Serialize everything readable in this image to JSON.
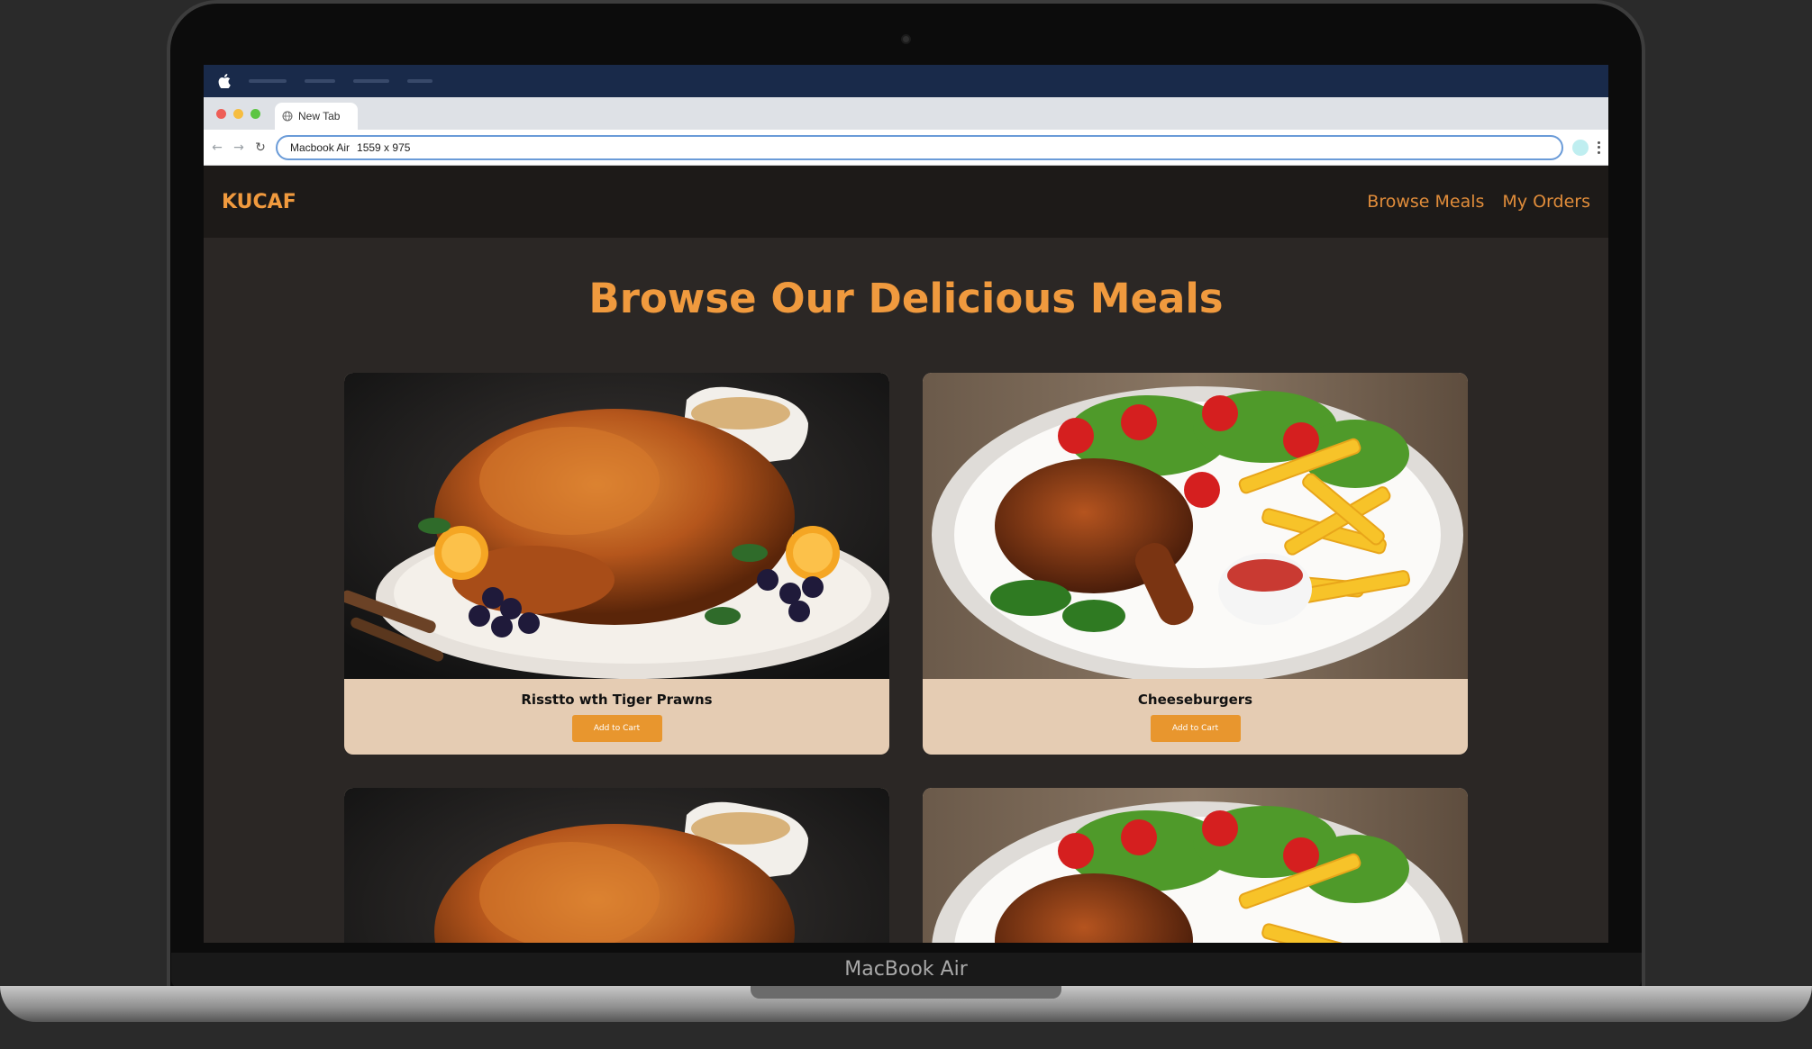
{
  "device": {
    "label": "MacBook Air"
  },
  "browser": {
    "tab_title": "New Tab",
    "url_device": "Macbook Air",
    "url_size": "1559 x 975"
  },
  "site": {
    "brand": "KUCAF",
    "nav": [
      "Browse Meals",
      "My Orders"
    ],
    "heading": "Browse Our Delicious Meals"
  },
  "meals": [
    {
      "name": "Risstto wth Tiger Prawns",
      "button": "Add to Cart",
      "image": "roast-turkey"
    },
    {
      "name": "Cheeseburgers",
      "button": "Add to Cart",
      "image": "chicken-fries-salad"
    },
    {
      "name": "",
      "button": "",
      "image": "roast-turkey"
    },
    {
      "name": "",
      "button": "",
      "image": "chicken-fries-salad"
    }
  ],
  "colors": {
    "accent": "#f09a3e",
    "button": "#e8962e",
    "card_bg": "#e5ccb3",
    "page_bg": "#2b2725"
  }
}
